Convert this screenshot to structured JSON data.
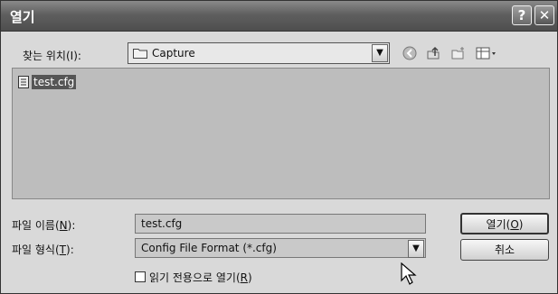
{
  "window": {
    "title": "열기"
  },
  "lookin": {
    "label": "찾는 위치(I):",
    "value": "Capture"
  },
  "files": [
    {
      "name": "test.cfg",
      "selected": true
    }
  ],
  "filename": {
    "label": "파일 이름(",
    "label_key": "N",
    "label_end": "):",
    "value": "test.cfg"
  },
  "filetype": {
    "label": "파일 형식(",
    "label_key": "T",
    "label_end": "):",
    "value": "Config File Format (*.cfg)"
  },
  "buttons": {
    "open": "열기(",
    "open_key": "O",
    "open_end": ")",
    "cancel": "취소"
  },
  "readonly": {
    "label": "읽기 전용으로 열기(",
    "label_key": "R",
    "label_end": ")",
    "checked": false
  },
  "colors": {
    "titlebar": "#5f5f5f",
    "list_bg": "#bdbdbd",
    "selection": "#555555"
  }
}
